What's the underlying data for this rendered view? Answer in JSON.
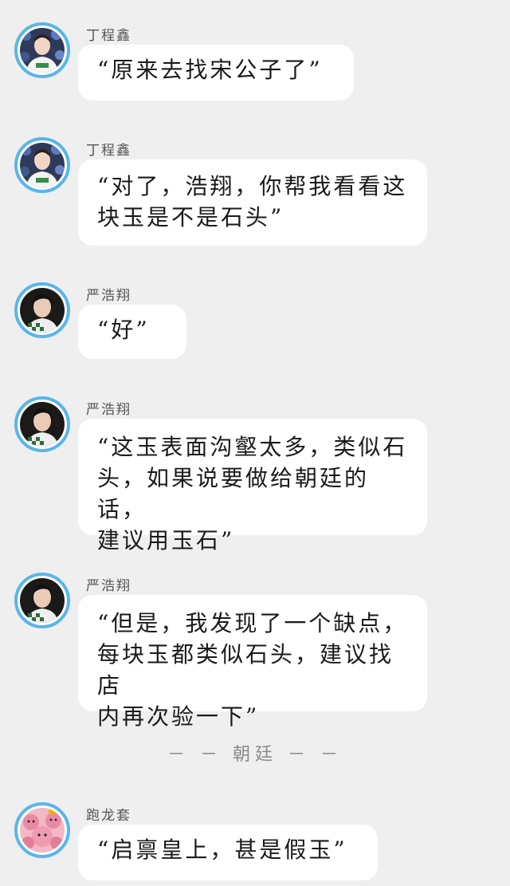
{
  "messages": [
    {
      "name": "丁程鑫",
      "text": "“原来去找宋公子了”",
      "avatar": "avatar-boy-green-shirt"
    },
    {
      "name": "丁程鑫",
      "text": "“对了，浩翔，你帮我看看这\n块玉是不是石头”",
      "avatar": "avatar-boy-green-shirt"
    },
    {
      "name": "严浩翔",
      "text": "“好”",
      "avatar": "avatar-boy-checkered-scarf"
    },
    {
      "name": "严浩翔",
      "text": "“这玉表面沟壑太多，类似石\n头，如果说要做给朝廷的话，\n建议用玉石”",
      "avatar": "avatar-boy-checkered-scarf"
    },
    {
      "name": "严浩翔",
      "text": "“但是，我发现了一个缺点，\n每块玉都类似石头，建议找店\n内再次验一下”",
      "avatar": "avatar-boy-checkered-scarf"
    },
    {
      "name": "跑龙套",
      "text": "“启禀皇上，甚是假玉”",
      "avatar": "avatar-pink-bears"
    }
  ],
  "divider": "－ － 朝廷 － －",
  "colors": {
    "background": "#efefef",
    "bubble": "#ffffff",
    "avatar_ring": "#58b6ea"
  }
}
